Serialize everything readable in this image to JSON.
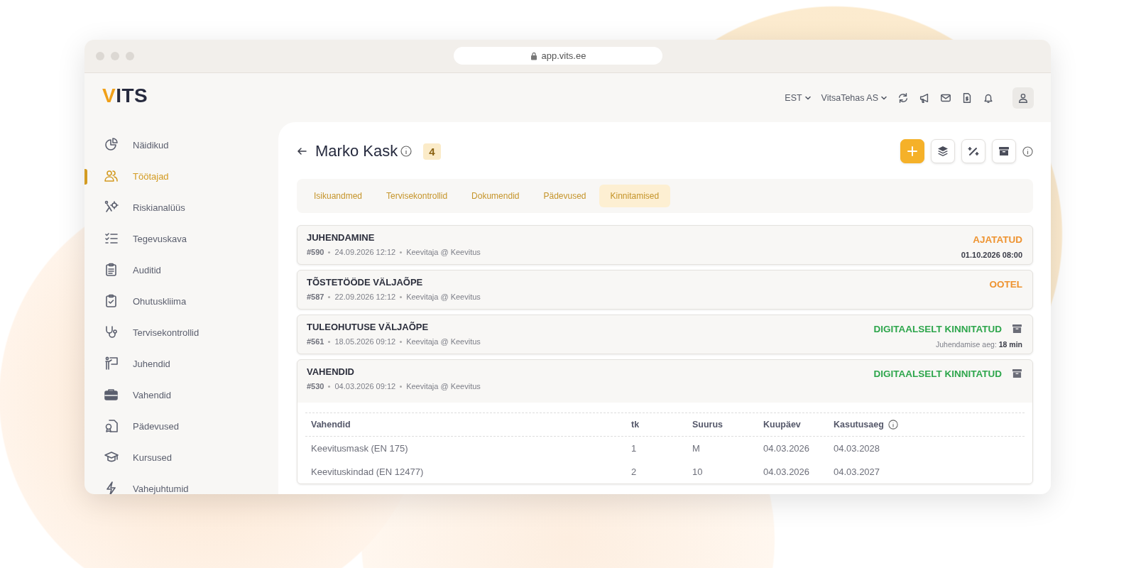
{
  "browser": {
    "url": "app.vits.ee"
  },
  "logo": {
    "accent": "V",
    "rest": "ITS"
  },
  "header": {
    "language": "EST",
    "company": "VitsaTehas AS"
  },
  "sidebar": {
    "items": [
      {
        "label": "Näidikud",
        "selected": false
      },
      {
        "label": "Töötajad",
        "selected": true
      },
      {
        "label": "Riskianalüüs",
        "selected": false
      },
      {
        "label": "Tegevuskava",
        "selected": false
      },
      {
        "label": "Auditid",
        "selected": false
      },
      {
        "label": "Ohutuskliima",
        "selected": false
      },
      {
        "label": "Tervisekontrollid",
        "selected": false
      },
      {
        "label": "Juhendid",
        "selected": false
      },
      {
        "label": "Vahendid",
        "selected": false
      },
      {
        "label": "Pädevused",
        "selected": false
      },
      {
        "label": "Kursused",
        "selected": false
      },
      {
        "label": "Vahejuhtumid",
        "selected": false
      }
    ]
  },
  "page": {
    "title": "Marko Kask",
    "count": "4"
  },
  "tabs": [
    {
      "label": "Isikuandmed",
      "selected": false
    },
    {
      "label": "Tervisekontrollid",
      "selected": false
    },
    {
      "label": "Dokumendid",
      "selected": false
    },
    {
      "label": "Pädevused",
      "selected": false
    },
    {
      "label": "Kinnitamised",
      "selected": true
    }
  ],
  "trainings": [
    {
      "title": "JUHENDAMINE",
      "number": "#590",
      "date": "24.09.2026 12:12",
      "role": "Keevitaja @ Keevitus",
      "status": {
        "label": "AJATATUD",
        "color": "#ee9330"
      },
      "scheduled_time": "01.10.2026 08:00",
      "archivable": false,
      "expanded": false
    },
    {
      "title": "TÕSTETÖÖDE VÄLJAÕPE",
      "number": "#587",
      "date": "22.09.2026 12:12",
      "role": "Keevitaja @ Keevitus",
      "status": {
        "label": "OOTEL",
        "color": "#ee9330"
      },
      "archivable": false,
      "expanded": false
    },
    {
      "title": "TULEOHUTUSE VÄLJAÕPE",
      "number": "#561",
      "date": "18.05.2026 09:12",
      "role": "Keevitaja @ Keevitus",
      "status": {
        "label": "DIGITAALSELT KINNITATUD",
        "color": "#2ea64c"
      },
      "detail": "Juhendamise aeg: **18 min**",
      "archivable": true,
      "expanded": false
    },
    {
      "title": "VAHENDID",
      "number": "#530",
      "date": "04.03.2026 09:12",
      "role": "Keevitaja @ Keevitus",
      "status": {
        "label": "DIGITAALSELT KINNITATUD",
        "color": "#2ea64c"
      },
      "archivable": true,
      "expanded": true,
      "equipment": {
        "columns": [
          "Vahendid",
          "tk",
          "Suurus",
          "Kuupäev",
          "Kasutusaeg"
        ],
        "rows": [
          [
            "Keevitusmask (EN 175)",
            "1",
            "M",
            "04.03.2026",
            "04.03.2028"
          ],
          [
            "Keevituskindad (EN 12477)",
            "2",
            "10",
            "04.03.2026",
            "04.03.2027"
          ]
        ]
      }
    }
  ]
}
